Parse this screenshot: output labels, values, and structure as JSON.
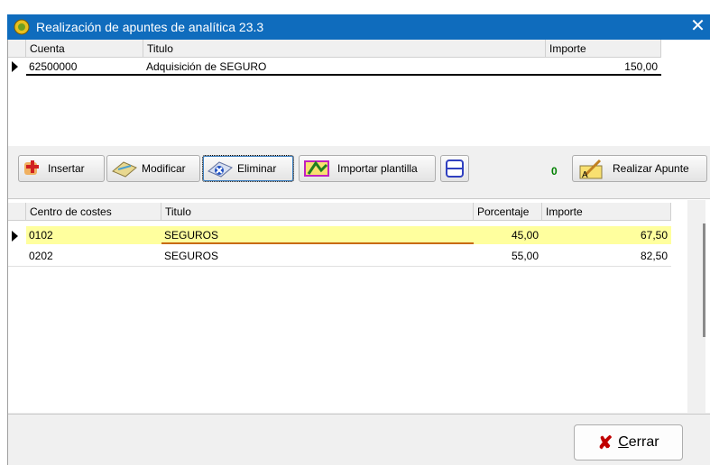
{
  "window": {
    "title": "Realización de apuntes de analítica  23.3",
    "close_glyph": "✕"
  },
  "accounts_grid": {
    "headers": [
      "Cuenta",
      "Titulo",
      "Importe"
    ],
    "rows": [
      {
        "cuenta": "62500000",
        "titulo": "Adquisición de SEGURO",
        "importe": "150,00"
      }
    ]
  },
  "toolbar": {
    "insertar": "Insertar",
    "modificar": "Modificar",
    "eliminar": "Eliminar",
    "importar": "Importar plantilla",
    "counter": "0",
    "realizar": "Realizar Apunte"
  },
  "cost_grid": {
    "headers": [
      "Centro de costes",
      "Titulo",
      "Porcentaje",
      "Importe"
    ],
    "rows": [
      {
        "centro": "0102",
        "titulo": "SEGUROS",
        "porcentaje": "45,00",
        "importe": "67,50"
      },
      {
        "centro": "0202",
        "titulo": "SEGUROS",
        "porcentaje": "55,00",
        "importe": "82,50"
      }
    ]
  },
  "footer": {
    "cerrar_underlined": "C",
    "cerrar_rest": "errar"
  },
  "colors": {
    "titlebar": "#0f6cbd",
    "selected_row": "#ffff9e",
    "counter": "#008000",
    "cerrar_x": "#c00000"
  }
}
